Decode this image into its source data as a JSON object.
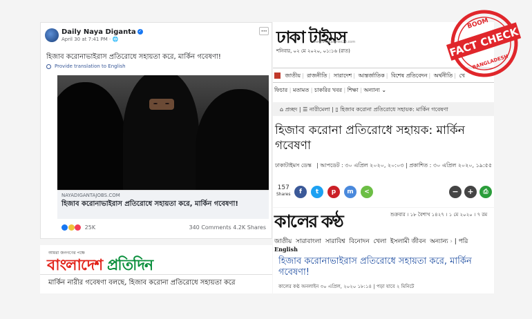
{
  "facebook_post": {
    "page_name": "Daily Naya Diganta",
    "verified_icon": "verified-check-icon",
    "timestamp": "April 30 at 7:41 PM · ",
    "more_icon": "···",
    "text": "হিজাব করোনাভাইরাস প্রতিরোধে সহায়তা করে, মার্কিন গবেষণা!",
    "translate_link": "Provide translation to English",
    "link_domain": "NAYADIGANTAJOBS.COM",
    "link_title": "হিজাব করোনাভাইরাস প্রতিরোধে সহায়তা করে, মার্কিন গবেষণা!",
    "reactions_count": "25K",
    "comments": "340 Comments",
    "shares": "4.2K Shares"
  },
  "bangladesh_pratidin": {
    "tagline": "আমরা জনগণের পক্ষে",
    "logo_part1": "বাংলাদেশ ",
    "logo_part2": "প্রতিদিন",
    "headline": "মার্কিন নারীর গবেষণা বলছে, হিজাব করোনা প্রতিরোধে সহায়তা করে"
  },
  "dhaka_times": {
    "logo": "ঢাকা টাইমস",
    "logo_url": "www.dhakatimes24.com",
    "date": "শনিবার, ০২ মে ২০২০, ০১:১৬ (রাত)",
    "nav_items": [
      "জাতীয়",
      "রাজনীতি",
      "সারাদেশ",
      "আন্তর্জাতিক",
      "বিশেষ প্রতিবেদন",
      "অর্থনীতি",
      "খে"
    ],
    "nav_items_2": [
      "ফিচার",
      "মতামত",
      "চাকরির খবর",
      "শিক্ষা",
      "অন্যান্য ⌄"
    ],
    "breadcrumb": [
      "প্রচ্ছদ",
      "নারীমেলা",
      "হিজাব করোনা প্রতিরোধে সহায়ক: মার্কিন গবেষণা"
    ],
    "title": "হিজাব করোনা প্রতিরোধে সহায়ক: মার্কিন গবেষণা",
    "byline": "ঢাকাটাইমস ডেস্ক",
    "dates": "| আপডেট : ৩০ এপ্রিল ২০২০, ২০:০৩ | প্রকাশিত : ৩০ এপ্রিল ২০২০, ১৯:৫৫",
    "share_count": "157",
    "share_label": "Shares"
  },
  "kaler_kantho": {
    "logo": "কালের কণ্ঠ",
    "date": "শুক্রবার । ১৮ বৈশাখ ১৪২৭ । ১ মে ২০২০ । ৭ রম",
    "nav_items": [
      "জাতীয়",
      "সারাবাংলা",
      "সারাবিশ্ব",
      "বিনোদন",
      "খেলা",
      "ইসলামী জীবন",
      "অন্যান্য",
      "পরি"
    ],
    "english_label": "English",
    "title": "হিজাব করোনাভাইরাস প্রতিরোধে সহায়তা করে, মার্কিন গবেষণা!",
    "meta": "কালের কণ্ঠ অনলাইন   ৩০ এপ্রিল, ২০২০ ১৮:১৪ | পড়া যাবে ২ মিনিটে"
  },
  "stamp": {
    "boom": "BOOM",
    "fact_check": "FACT CHECK",
    "country": "BANGLADESH",
    "color": "#e0262b"
  }
}
